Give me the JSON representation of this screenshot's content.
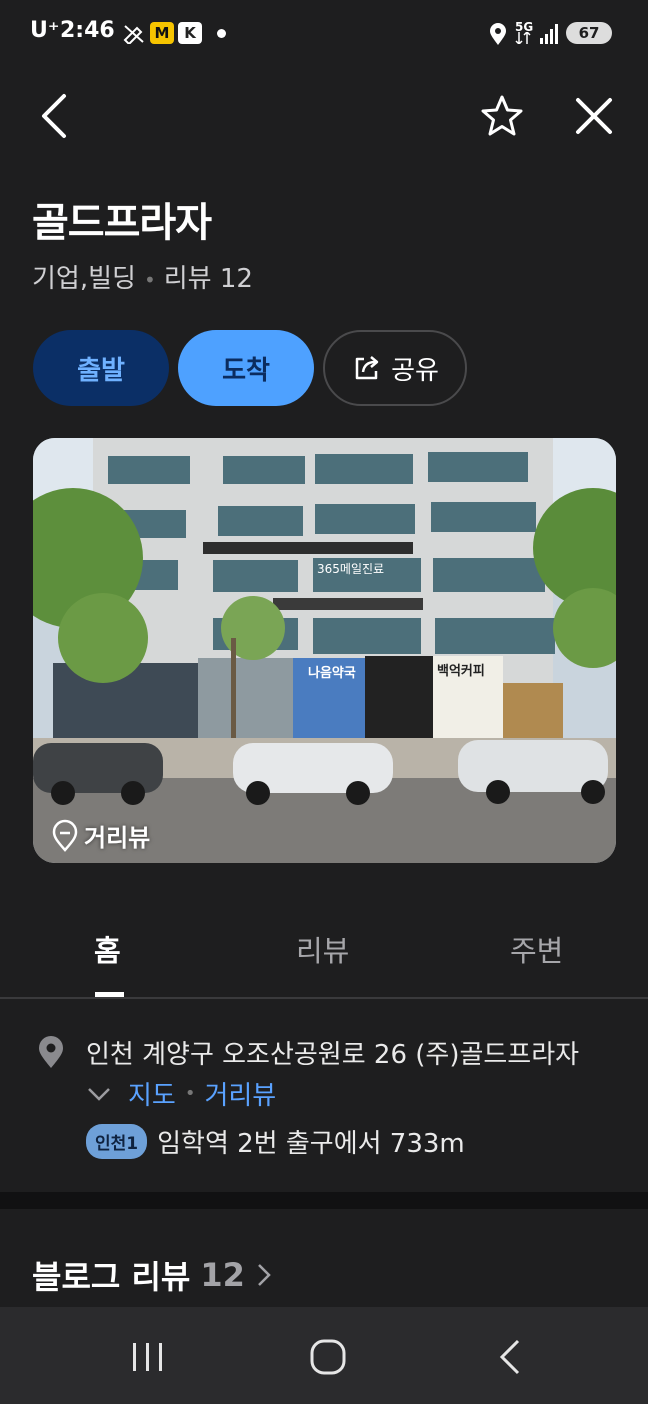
{
  "status_bar": {
    "carrier": "U⁺",
    "time": "2:46",
    "badge_m": "M",
    "badge_k": "K",
    "network": "5G",
    "battery": "67"
  },
  "place": {
    "name": "골드프라자",
    "category": "기업,빌딩",
    "review_label": "리뷰 12"
  },
  "actions": {
    "start": "출발",
    "arrive": "도착",
    "share": "공유"
  },
  "photo": {
    "streetview_label": "거리뷰",
    "sign_texts": [
      "나음약국",
      "백억커피",
      "365메일진료"
    ]
  },
  "tabs": [
    {
      "label": "홈",
      "active": true
    },
    {
      "label": "리뷰",
      "active": false
    },
    {
      "label": "주변",
      "active": false
    }
  ],
  "info": {
    "address": "인천 계양구 오조산공원로 26 (주)골드프라자",
    "map_link": "지도",
    "streetview_link": "거리뷰",
    "subway_badge": "인천1",
    "subway_text": "임학역 2번 출구에서 733m"
  },
  "blog": {
    "label": "블로그 리뷰",
    "count": "12"
  },
  "colors": {
    "background": "#1e1e1f",
    "accent_blue": "#4ea1ff",
    "link_blue": "#5aa2ff",
    "start_button_bg": "#0b2f66"
  }
}
